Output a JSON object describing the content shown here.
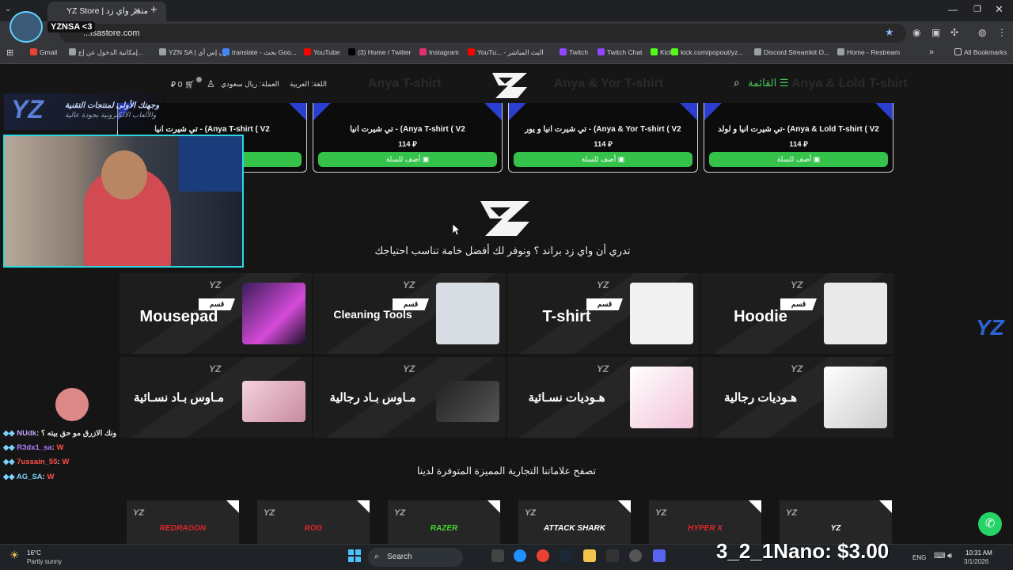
{
  "browser": {
    "tab_title": "YZ Store | متجر واي زد",
    "url": "...isastore.com",
    "bookmarks": [
      {
        "label": "Gmail",
        "color": "#ea4335"
      },
      {
        "label": "إمكانية الدخول عن إع...",
        "color": "#9aa0a6"
      },
      {
        "label": "YZN SA | يزن إس أي",
        "color": "#9aa0a6"
      },
      {
        "label": "translate - بحث Goo...",
        "color": "#4285f4"
      },
      {
        "label": "YouTube",
        "color": "#ff0000"
      },
      {
        "label": "(3) Home / Twitter",
        "color": "#000000"
      },
      {
        "label": "Instagram",
        "color": "#e1306c"
      },
      {
        "label": "YouTu... - البث المباشر",
        "color": "#ff0000"
      },
      {
        "label": "Twitch",
        "color": "#9146ff"
      },
      {
        "label": "Twitch Chat",
        "color": "#9146ff"
      },
      {
        "label": "Kick",
        "color": "#53fc18"
      },
      {
        "label": "kick.com/popout/yz...",
        "color": "#53fc18"
      },
      {
        "label": "Discord Streamkit O...",
        "color": "#9aa0a6"
      },
      {
        "label": "Home - Restream",
        "color": "#9aa0a6"
      }
    ],
    "all_bookmarks": "All Bookmarks"
  },
  "stream": {
    "streamer_name": "YZNSA <3",
    "banner_line1": "وجهتك الأولى لمنتجات التقنية",
    "banner_line2": "والألعاب الالكترونية بجودة عالية",
    "chat": [
      {
        "user": "NUdk",
        "text": "ونك الازرق مو حق بيته ؟",
        "color": "#c0a0ff"
      },
      {
        "user": "R3dx1_sa",
        "text": "W",
        "color": "#b07cff"
      },
      {
        "user": "7ussain_55",
        "text": "W",
        "color": "#ff4d4d"
      },
      {
        "user": "AG_SA",
        "text": "W",
        "color": "#7cd3ff"
      }
    ],
    "nano_text": "3_2_1Nano: $3.00"
  },
  "site": {
    "menu_label": "القائمة",
    "language": "اللغة: العربية",
    "currency": "العملة: ريال سعودي",
    "cart_count": "0",
    "header_ghost": [
      "Anya & Lold T-shirt",
      "Anya & Yor T-shirt",
      "Anya T-shirt"
    ],
    "products": [
      {
        "name": "تي شيرت انيا و لولد- (Anya & Lold T-shirt ( V2",
        "price": "114",
        "button": "أضف للسلة"
      },
      {
        "name": "تي شيرت انيا و يور - (Anya & Yor T-shirt ( V2",
        "price": "114",
        "button": "أضف للسلة"
      },
      {
        "name": "تي شيرت انيا - (Anya T-shirt ( V2",
        "price": "114",
        "button": "أضف للسلة"
      },
      {
        "name": "تي شيرت انيا - (Anya T-shirt ( V2",
        "price": "",
        "button": "أضف للسلة"
      }
    ],
    "tagline": "تدري أن واي زد براند ؟ ونوفر لك أفضل خامة تناسب احتياجك",
    "category_badge": "قسم",
    "categories_row1": [
      "Hoodie",
      "T-shirt",
      "Cleaning Tools",
      "Mousepad"
    ],
    "categories_row2": [
      "هـوديات رجالية",
      "هـوديات نسـائية",
      "مـاوس بـاد رجالية",
      "مـاوس بـاد نسـائية"
    ],
    "brands_title": "تصفح علاماتنا التجارية المميزة المتوفرة لدينا",
    "brands": [
      {
        "name": "YZ",
        "color": "#ffffff"
      },
      {
        "name": "HYPER X",
        "color": "#e0252b"
      },
      {
        "name": "ATTACK SHARK",
        "color": "#ffffff"
      },
      {
        "name": "RAZER",
        "color": "#44d62c"
      },
      {
        "name": "ROG",
        "color": "#e0252b"
      },
      {
        "name": "REDRAGON",
        "color": "#e0252b"
      }
    ]
  },
  "taskbar": {
    "weather_temp": "16°C",
    "weather_desc": "Partly sunny",
    "search": "Search",
    "lang": "ENG",
    "time": "10:31 AM",
    "date": "3/1/2026"
  }
}
